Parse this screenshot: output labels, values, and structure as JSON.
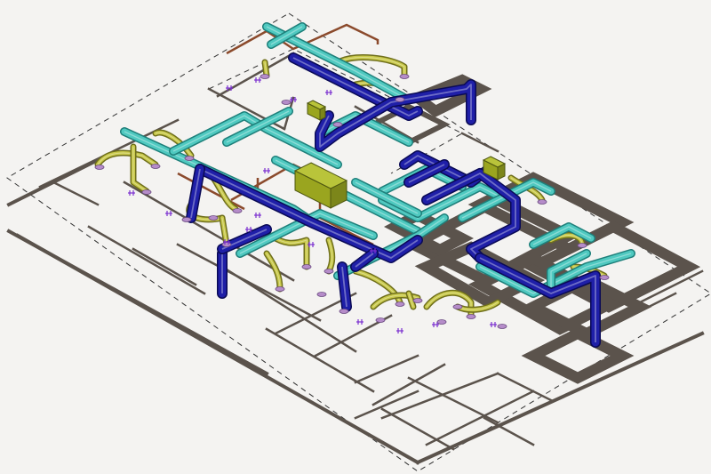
{
  "colors": {
    "background": "#f4f3f1",
    "wall": "#5b534c",
    "supply_duct": "#1f1fa8",
    "supply_duct_edge": "#0a0a55",
    "return_duct": "#4fc9c0",
    "return_duct_edge": "#1e7f7a",
    "flex_duct": "#c9c94a",
    "flex_duct_edge": "#6f6f1c",
    "equipment": "#9aa51f",
    "equipment_edge": "#4d5510",
    "refrigerant_pipe": "#8b4a2c",
    "diffuser": "#b58cc9",
    "sensor_marker": "#7b2fd0"
  },
  "legend": {
    "supply_icon": "supply-duct-icon",
    "return_icon": "return-duct-icon",
    "flex_icon": "flex-duct-icon",
    "equipment_icon": "air-handler-icon"
  }
}
